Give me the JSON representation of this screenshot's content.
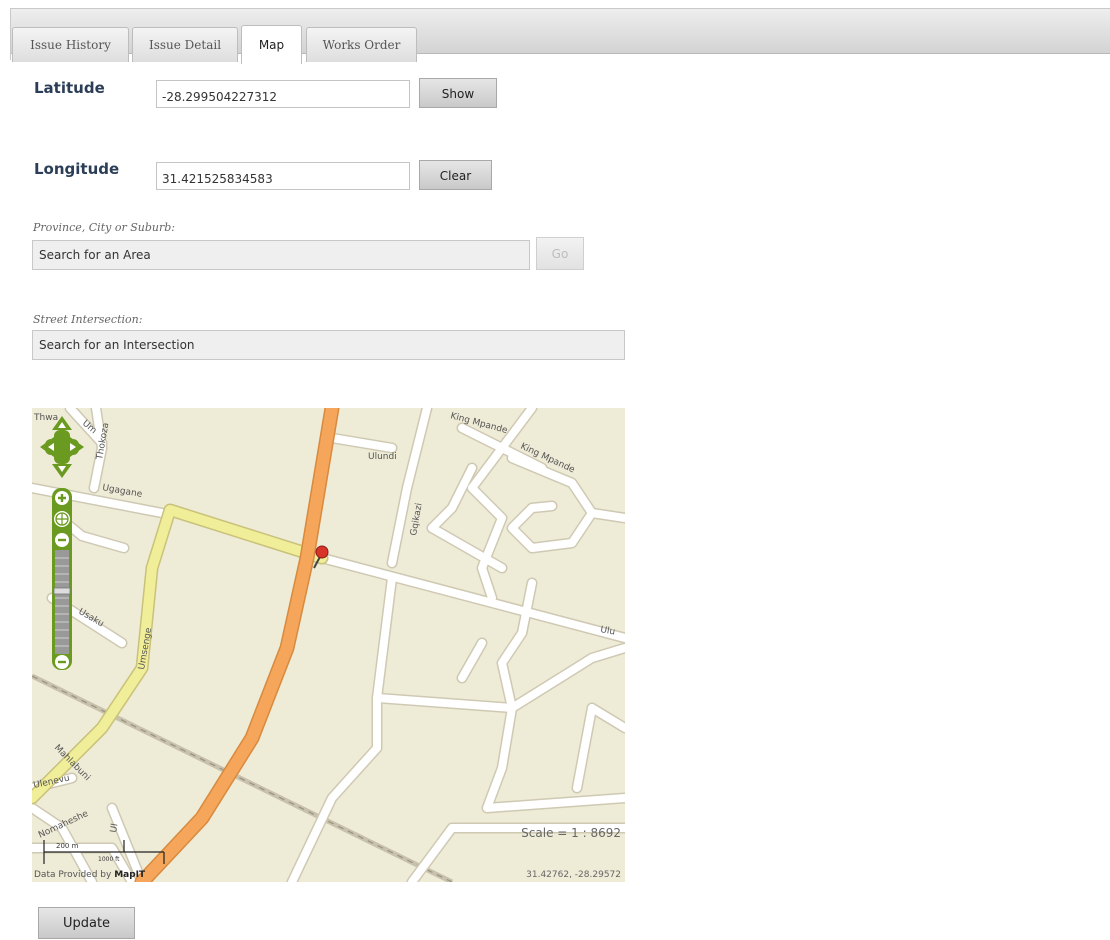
{
  "tabs": [
    {
      "label": "Issue History",
      "active": false
    },
    {
      "label": "Issue Detail",
      "active": false
    },
    {
      "label": "Map",
      "active": true
    },
    {
      "label": "Works Order",
      "active": false
    }
  ],
  "latitude": {
    "label": "Latitude",
    "value": "-28.299504227312",
    "button": "Show"
  },
  "longitude": {
    "label": "Longitude",
    "value": "31.421525834583",
    "button": "Clear"
  },
  "area_search": {
    "label": "Province, City or Suburb:",
    "placeholder": "Search for an Area",
    "button": "Go"
  },
  "intersection_search": {
    "label": "Street Intersection:",
    "placeholder": "Search for an Intersection"
  },
  "map": {
    "street_labels": [
      "Thwa",
      "Um",
      "Thokoza",
      "Ulundi",
      "King Mpande",
      "King Mpande",
      "Ugagane",
      "Gqikazi",
      "Ulu",
      "Usaku",
      "Umsenge",
      "Mahlabuni",
      "Ulenevu",
      "Nomaheshe",
      "Ul"
    ],
    "scale_text": "Scale = 1 : 8692",
    "scale_bar_m": "200 m",
    "scale_bar_ft": "1000 ft",
    "coords_text": "31.42762, -28.29572",
    "credit_prefix": "Data Provided by ",
    "credit_brand": "MapIT",
    "colors": {
      "land": "#eeebd6",
      "major_road": "#f5a65b",
      "secondary_road": "#f1ee9a",
      "minor_road": "#ffffff",
      "control": "#6a9a1f",
      "marker": "#d8342a"
    }
  },
  "update_button": "Update"
}
